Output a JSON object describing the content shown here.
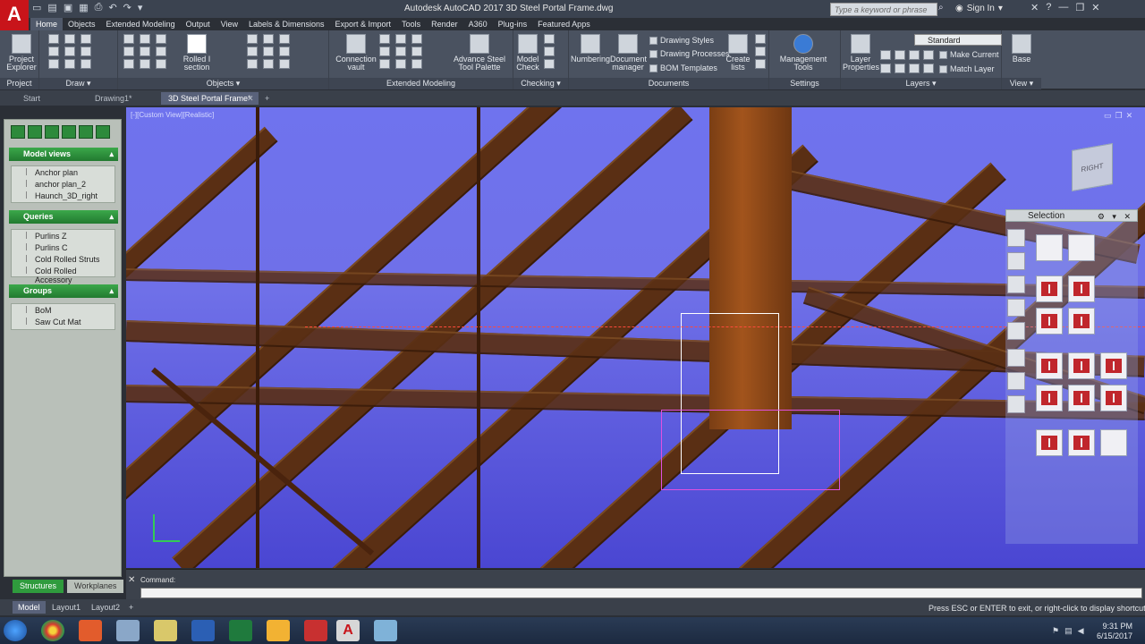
{
  "app": {
    "logo_letter": "A",
    "title": "Autodesk AutoCAD 2017   3D Steel Portal Frame.dwg",
    "search_placeholder": "Type a keyword or phrase",
    "sign_in": "Sign In"
  },
  "ribbon_tabs": [
    "Home",
    "Objects",
    "Extended Modeling",
    "Output",
    "View",
    "Labels & Dimensions",
    "Export & Import",
    "Tools",
    "Render",
    "A360",
    "Plug-ins",
    "Featured Apps"
  ],
  "ribbon": {
    "project_explorer": "Project Explorer",
    "rolled_i_section": "Rolled I section",
    "connection_vault": "Connection vault",
    "advance_steel_tool_palette": "Advance Steel Tool Palette",
    "model_check": "Model Check",
    "numbering": "Numbering",
    "document_manager": "Document manager",
    "drawing_styles": "Drawing Styles",
    "drawing_processes": "Drawing Processes",
    "bom_templates": "BOM Templates",
    "create_lists": "Create lists",
    "management_tools": "Management Tools",
    "layer_properties": "Layer Properties",
    "layer_current": "Standard",
    "make_current": "Make Current",
    "match_layer": "Match Layer",
    "base": "Base",
    "panels": {
      "project": "Project",
      "draw": "Draw",
      "objects": "Objects",
      "extended_modeling": "Extended Modeling",
      "checking": "Checking",
      "documents": "Documents",
      "settings": "Settings",
      "layers": "Layers",
      "view": "View"
    }
  },
  "doc_tabs": [
    "Start",
    "Drawing1*",
    "3D Steel Portal Frame*"
  ],
  "viewport": {
    "label": "[-][Custom View][Realistic]",
    "viewcube_face": "RIGHT"
  },
  "palette": {
    "model_views_title": "Model views",
    "model_views": [
      "Anchor plan",
      "anchor plan_2",
      "Haunch_3D_right"
    ],
    "queries_title": "Queries",
    "queries": [
      "Purlins Z",
      "Purlins C",
      "Cold Rolled Struts",
      "Cold Rolled Accessory"
    ],
    "groups_title": "Groups",
    "groups": [
      "BoM",
      "Saw Cut Mat"
    ],
    "tabs": [
      "Structures",
      "Workplanes"
    ]
  },
  "selection_palette": {
    "title": "Selection"
  },
  "command": {
    "prompt": "Command:"
  },
  "layout_tabs": [
    "Model",
    "Layout1",
    "Layout2"
  ],
  "status_message": "Press ESC or ENTER to exit, or right-click to display shortcut-menu.",
  "clock": {
    "time": "9:31 PM",
    "date": "6/15/2017"
  },
  "colors": {
    "accent_green": "#2f9b3d",
    "autocad_red": "#c8141a",
    "viewport_blue": "#6f73ee",
    "steel_brown": "#5a2f14"
  }
}
